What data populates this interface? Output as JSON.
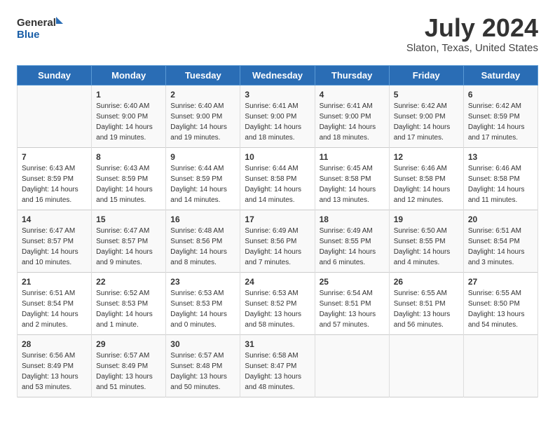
{
  "header": {
    "logo_line1": "General",
    "logo_line2": "Blue",
    "month": "July 2024",
    "location": "Slaton, Texas, United States"
  },
  "days_of_week": [
    "Sunday",
    "Monday",
    "Tuesday",
    "Wednesday",
    "Thursday",
    "Friday",
    "Saturday"
  ],
  "weeks": [
    [
      {
        "day": "",
        "sunrise": "",
        "sunset": "",
        "daylight": ""
      },
      {
        "day": "1",
        "sunrise": "Sunrise: 6:40 AM",
        "sunset": "Sunset: 9:00 PM",
        "daylight": "Daylight: 14 hours and 19 minutes."
      },
      {
        "day": "2",
        "sunrise": "Sunrise: 6:40 AM",
        "sunset": "Sunset: 9:00 PM",
        "daylight": "Daylight: 14 hours and 19 minutes."
      },
      {
        "day": "3",
        "sunrise": "Sunrise: 6:41 AM",
        "sunset": "Sunset: 9:00 PM",
        "daylight": "Daylight: 14 hours and 18 minutes."
      },
      {
        "day": "4",
        "sunrise": "Sunrise: 6:41 AM",
        "sunset": "Sunset: 9:00 PM",
        "daylight": "Daylight: 14 hours and 18 minutes."
      },
      {
        "day": "5",
        "sunrise": "Sunrise: 6:42 AM",
        "sunset": "Sunset: 9:00 PM",
        "daylight": "Daylight: 14 hours and 17 minutes."
      },
      {
        "day": "6",
        "sunrise": "Sunrise: 6:42 AM",
        "sunset": "Sunset: 8:59 PM",
        "daylight": "Daylight: 14 hours and 17 minutes."
      }
    ],
    [
      {
        "day": "7",
        "sunrise": "Sunrise: 6:43 AM",
        "sunset": "Sunset: 8:59 PM",
        "daylight": "Daylight: 14 hours and 16 minutes."
      },
      {
        "day": "8",
        "sunrise": "Sunrise: 6:43 AM",
        "sunset": "Sunset: 8:59 PM",
        "daylight": "Daylight: 14 hours and 15 minutes."
      },
      {
        "day": "9",
        "sunrise": "Sunrise: 6:44 AM",
        "sunset": "Sunset: 8:59 PM",
        "daylight": "Daylight: 14 hours and 14 minutes."
      },
      {
        "day": "10",
        "sunrise": "Sunrise: 6:44 AM",
        "sunset": "Sunset: 8:58 PM",
        "daylight": "Daylight: 14 hours and 14 minutes."
      },
      {
        "day": "11",
        "sunrise": "Sunrise: 6:45 AM",
        "sunset": "Sunset: 8:58 PM",
        "daylight": "Daylight: 14 hours and 13 minutes."
      },
      {
        "day": "12",
        "sunrise": "Sunrise: 6:46 AM",
        "sunset": "Sunset: 8:58 PM",
        "daylight": "Daylight: 14 hours and 12 minutes."
      },
      {
        "day": "13",
        "sunrise": "Sunrise: 6:46 AM",
        "sunset": "Sunset: 8:58 PM",
        "daylight": "Daylight: 14 hours and 11 minutes."
      }
    ],
    [
      {
        "day": "14",
        "sunrise": "Sunrise: 6:47 AM",
        "sunset": "Sunset: 8:57 PM",
        "daylight": "Daylight: 14 hours and 10 minutes."
      },
      {
        "day": "15",
        "sunrise": "Sunrise: 6:47 AM",
        "sunset": "Sunset: 8:57 PM",
        "daylight": "Daylight: 14 hours and 9 minutes."
      },
      {
        "day": "16",
        "sunrise": "Sunrise: 6:48 AM",
        "sunset": "Sunset: 8:56 PM",
        "daylight": "Daylight: 14 hours and 8 minutes."
      },
      {
        "day": "17",
        "sunrise": "Sunrise: 6:49 AM",
        "sunset": "Sunset: 8:56 PM",
        "daylight": "Daylight: 14 hours and 7 minutes."
      },
      {
        "day": "18",
        "sunrise": "Sunrise: 6:49 AM",
        "sunset": "Sunset: 8:55 PM",
        "daylight": "Daylight: 14 hours and 6 minutes."
      },
      {
        "day": "19",
        "sunrise": "Sunrise: 6:50 AM",
        "sunset": "Sunset: 8:55 PM",
        "daylight": "Daylight: 14 hours and 4 minutes."
      },
      {
        "day": "20",
        "sunrise": "Sunrise: 6:51 AM",
        "sunset": "Sunset: 8:54 PM",
        "daylight": "Daylight: 14 hours and 3 minutes."
      }
    ],
    [
      {
        "day": "21",
        "sunrise": "Sunrise: 6:51 AM",
        "sunset": "Sunset: 8:54 PM",
        "daylight": "Daylight: 14 hours and 2 minutes."
      },
      {
        "day": "22",
        "sunrise": "Sunrise: 6:52 AM",
        "sunset": "Sunset: 8:53 PM",
        "daylight": "Daylight: 14 hours and 1 minute."
      },
      {
        "day": "23",
        "sunrise": "Sunrise: 6:53 AM",
        "sunset": "Sunset: 8:53 PM",
        "daylight": "Daylight: 14 hours and 0 minutes."
      },
      {
        "day": "24",
        "sunrise": "Sunrise: 6:53 AM",
        "sunset": "Sunset: 8:52 PM",
        "daylight": "Daylight: 13 hours and 58 minutes."
      },
      {
        "day": "25",
        "sunrise": "Sunrise: 6:54 AM",
        "sunset": "Sunset: 8:51 PM",
        "daylight": "Daylight: 13 hours and 57 minutes."
      },
      {
        "day": "26",
        "sunrise": "Sunrise: 6:55 AM",
        "sunset": "Sunset: 8:51 PM",
        "daylight": "Daylight: 13 hours and 56 minutes."
      },
      {
        "day": "27",
        "sunrise": "Sunrise: 6:55 AM",
        "sunset": "Sunset: 8:50 PM",
        "daylight": "Daylight: 13 hours and 54 minutes."
      }
    ],
    [
      {
        "day": "28",
        "sunrise": "Sunrise: 6:56 AM",
        "sunset": "Sunset: 8:49 PM",
        "daylight": "Daylight: 13 hours and 53 minutes."
      },
      {
        "day": "29",
        "sunrise": "Sunrise: 6:57 AM",
        "sunset": "Sunset: 8:49 PM",
        "daylight": "Daylight: 13 hours and 51 minutes."
      },
      {
        "day": "30",
        "sunrise": "Sunrise: 6:57 AM",
        "sunset": "Sunset: 8:48 PM",
        "daylight": "Daylight: 13 hours and 50 minutes."
      },
      {
        "day": "31",
        "sunrise": "Sunrise: 6:58 AM",
        "sunset": "Sunset: 8:47 PM",
        "daylight": "Daylight: 13 hours and 48 minutes."
      },
      {
        "day": "",
        "sunrise": "",
        "sunset": "",
        "daylight": ""
      },
      {
        "day": "",
        "sunrise": "",
        "sunset": "",
        "daylight": ""
      },
      {
        "day": "",
        "sunrise": "",
        "sunset": "",
        "daylight": ""
      }
    ]
  ]
}
